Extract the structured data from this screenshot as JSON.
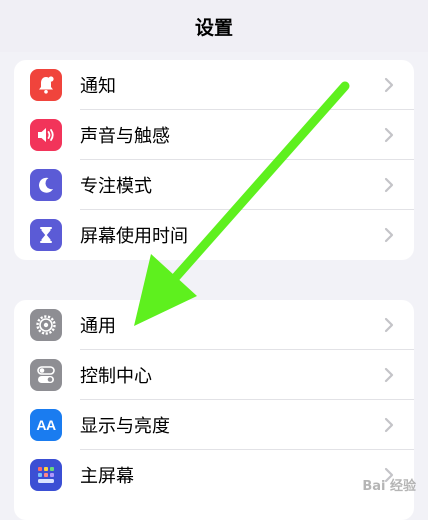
{
  "header": {
    "title": "设置"
  },
  "groups": [
    {
      "items": [
        {
          "label": "通知",
          "icon": "bell-icon",
          "color": "#f0443c"
        },
        {
          "label": "声音与触感",
          "icon": "speaker-icon",
          "color": "#f2345a"
        },
        {
          "label": "专注模式",
          "icon": "moon-icon",
          "color": "#5b5bd6"
        },
        {
          "label": "屏幕使用时间",
          "icon": "hourglass-icon",
          "color": "#5b5bd6"
        }
      ]
    },
    {
      "items": [
        {
          "label": "通用",
          "icon": "gear-icon",
          "color": "#8e8e93"
        },
        {
          "label": "控制中心",
          "icon": "toggles-icon",
          "color": "#8e8e93"
        },
        {
          "label": "显示与亮度",
          "icon": "aa-icon",
          "color": "#1a7cf0",
          "icon_text": "AA"
        },
        {
          "label": "主屏幕",
          "icon": "home-grid-icon",
          "color": "#3b4fd4"
        }
      ]
    }
  ],
  "annotation": {
    "color": "#5ef01e"
  },
  "watermark": {
    "text": "Bai 经验"
  }
}
